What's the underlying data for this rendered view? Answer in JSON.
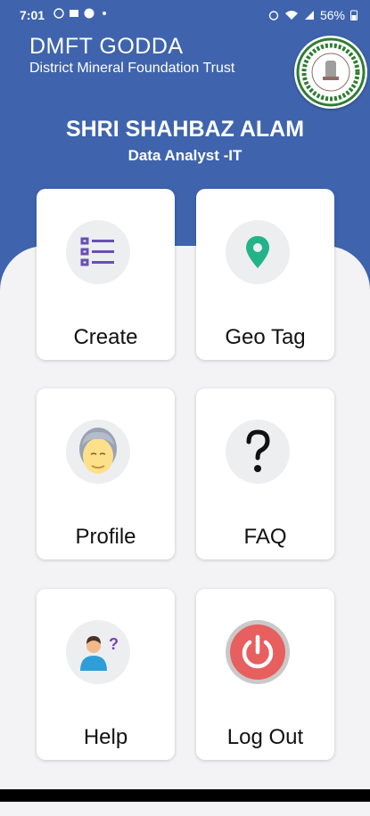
{
  "status_bar": {
    "time": "7:01",
    "battery": "56%"
  },
  "header": {
    "title": "DMFT GODDA",
    "subtitle": "District Mineral Foundation Trust"
  },
  "user": {
    "name": "SHRI SHAHBAZ ALAM",
    "role": "Data Analyst -IT"
  },
  "menu": [
    {
      "label": "Create",
      "icon": "list-icon"
    },
    {
      "label": "Geo Tag",
      "icon": "location-pin-icon"
    },
    {
      "label": "Profile",
      "icon": "avatar-icon"
    },
    {
      "label": "FAQ",
      "icon": "question-mark-icon"
    },
    {
      "label": "Help",
      "icon": "help-person-icon"
    },
    {
      "label": "Log Out",
      "icon": "power-icon"
    }
  ],
  "colors": {
    "header_bg": "#3f64ad",
    "accent_purple": "#6a4fb5",
    "accent_teal": "#22b38a",
    "logout_red": "#e85f5f"
  }
}
